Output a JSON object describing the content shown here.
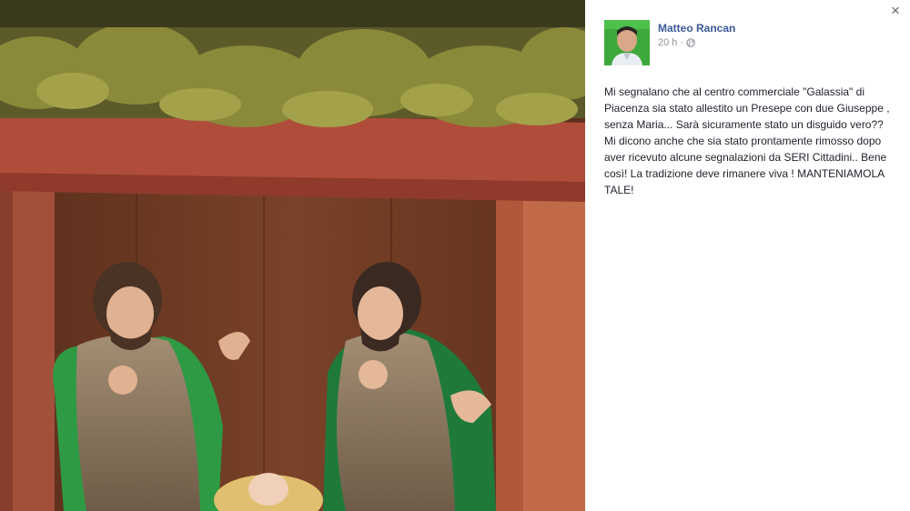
{
  "post": {
    "author": "Matteo Rancan",
    "time": "20 h",
    "separator": "·",
    "privacy_icon": "globe-icon",
    "text": "Mi segnalano che al centro commerciale \"Galassia\" di Piacenza sia stato allestito un Presepe con due Giuseppe , senza Maria... Sarà sicuramente stato un disguido vero?? Mi dicono anche che sia stato prontamente rimosso dopo aver ricevuto alcune segnalazioni da SERI Cittadini.. Bene così! La tradizione deve rimanere viva ! MANTENIAMOLA TALE!"
  },
  "viewer": {
    "close_label": "×"
  },
  "colors": {
    "author_link": "#3b5998",
    "meta_text": "#90949c",
    "body_text": "#1d2129",
    "avatar_bg": "#3ea83c"
  }
}
